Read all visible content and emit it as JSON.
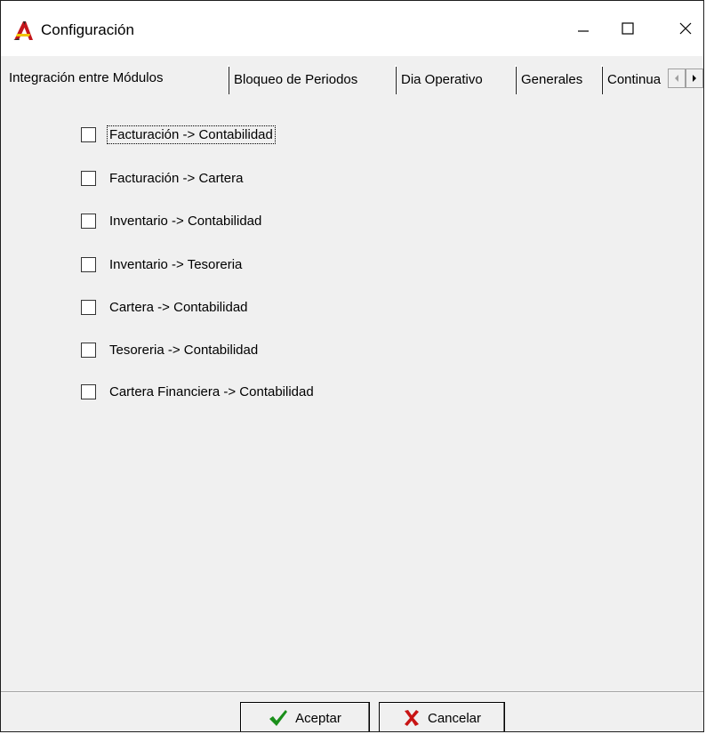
{
  "window": {
    "title": "Configuración"
  },
  "tabs": [
    {
      "label": "Integración entre Módulos",
      "active": true
    },
    {
      "label": "Bloqueo de Periodos",
      "active": false
    },
    {
      "label": "Dia Operativo",
      "active": false
    },
    {
      "label": "Generales",
      "active": false
    },
    {
      "label": "Continua",
      "active": false
    }
  ],
  "checkboxes": [
    {
      "label": "Facturación -> Contabilidad",
      "checked": false,
      "focused": true
    },
    {
      "label": "Facturación -> Cartera",
      "checked": false
    },
    {
      "label": "Inventario -> Contabilidad",
      "checked": false
    },
    {
      "label": "Inventario -> Tesoreria",
      "checked": false
    },
    {
      "label": "Cartera -> Contabilidad",
      "checked": false
    },
    {
      "label": "Tesoreria -> Contabilidad",
      "checked": false
    },
    {
      "label": "Cartera Financiera -> Contabilidad",
      "checked": false
    }
  ],
  "buttons": {
    "ok_label": "Aceptar",
    "cancel_label": "Cancelar"
  },
  "colors": {
    "ok_check": "#1a8f1a",
    "cancel_x": "#c81414",
    "app_icon_red": "#c4161c",
    "app_icon_yellow": "#f2c400"
  },
  "icons": {
    "app": "app-logo-icon",
    "minimize": "minimize-icon",
    "maximize": "maximize-icon",
    "close": "close-icon",
    "ok": "checkmark-icon",
    "cancel": "x-mark-icon"
  }
}
